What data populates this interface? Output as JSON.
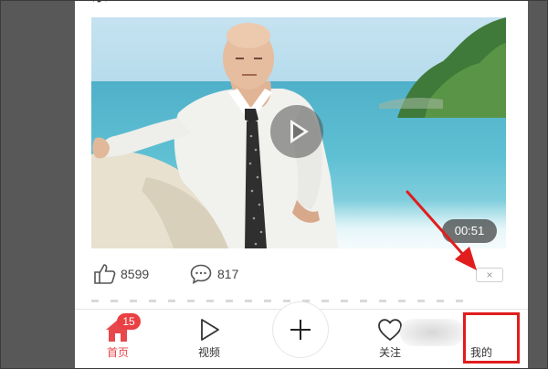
{
  "post": {
    "title_fragment": "东",
    "video": {
      "duration": "00:51"
    },
    "likes": "8599",
    "comments": "817",
    "close_label": "×"
  },
  "tabbar": {
    "home": {
      "label": "首页",
      "badge": "15",
      "icon": "home-icon"
    },
    "video": {
      "label": "视频",
      "icon": "play-outline-icon"
    },
    "publish": {
      "icon": "plus-icon"
    },
    "follow": {
      "label": "关注",
      "icon": "heart-icon"
    },
    "mine": {
      "label": "我的"
    }
  },
  "colors": {
    "accent": "#e8484b",
    "badge": "#ea3f43",
    "annotation": "#e11d1d",
    "sidebar": "#585858"
  }
}
